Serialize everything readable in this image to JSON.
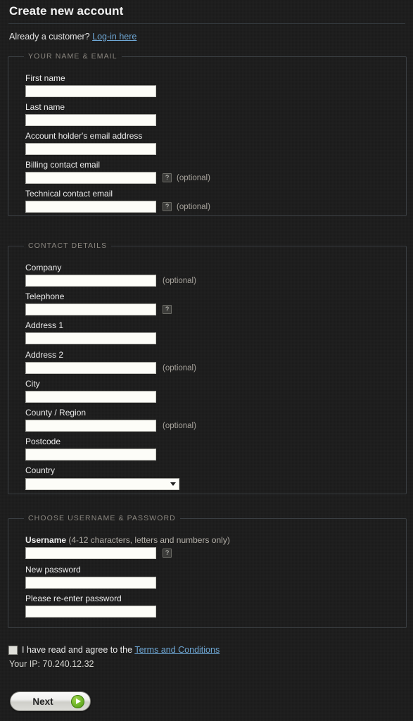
{
  "header": {
    "title": "Create new account",
    "already_text": "Already a customer?",
    "login_link": "Log-in here"
  },
  "sections": {
    "name_email": {
      "legend": "YOUR NAME & EMAIL",
      "fields": [
        {
          "label": "First name",
          "value": "",
          "optional": ""
        },
        {
          "label": "Last name",
          "value": "",
          "optional": ""
        },
        {
          "label": "Account holder's email address",
          "value": "",
          "optional": ""
        },
        {
          "label": "Billing contact email",
          "value": "",
          "optional": "(optional)",
          "help": "?"
        },
        {
          "label": "Technical contact email",
          "value": "",
          "optional": "(optional)",
          "help": "?"
        }
      ]
    },
    "contact_details": {
      "legend": "CONTACT DETAILS",
      "fields": [
        {
          "label": "Company",
          "value": "",
          "optional": "(optional)"
        },
        {
          "label": "Telephone",
          "value": "",
          "optional": "",
          "help": "?"
        },
        {
          "label": "Address 1",
          "value": "",
          "optional": ""
        },
        {
          "label": "Address 2",
          "value": "",
          "optional": "(optional)"
        },
        {
          "label": "City",
          "value": "",
          "optional": ""
        },
        {
          "label": "County / Region",
          "value": "",
          "optional": "(optional)"
        },
        {
          "label": "Postcode",
          "value": "",
          "optional": ""
        },
        {
          "label": "Country",
          "value": "",
          "optional": "",
          "selected_option": "",
          "options": [
            ""
          ]
        }
      ]
    },
    "username_password": {
      "legend": "CHOOSE USERNAME & PASSWORD",
      "fields": [
        {
          "label": "Username",
          "hint": "(4-12 characters, letters and numbers only)",
          "value": "",
          "help": "?"
        },
        {
          "label": "New password",
          "value": ""
        },
        {
          "label": "Please re-enter password",
          "value": ""
        }
      ]
    }
  },
  "footer": {
    "terms_checked": false,
    "terms_text": "I have read and agree to the",
    "terms_link": "Terms and Conditions",
    "ip_label": "Your IP:",
    "ip_value": "70.240.12.32",
    "next_label": "Next"
  },
  "colors": {
    "background": "#1b1b1b",
    "link": "#6fa8d6",
    "legend": "#8b8780",
    "label": "#ececec",
    "input_bg": "#fdfdf8",
    "accent_green": "#6fb52a"
  }
}
